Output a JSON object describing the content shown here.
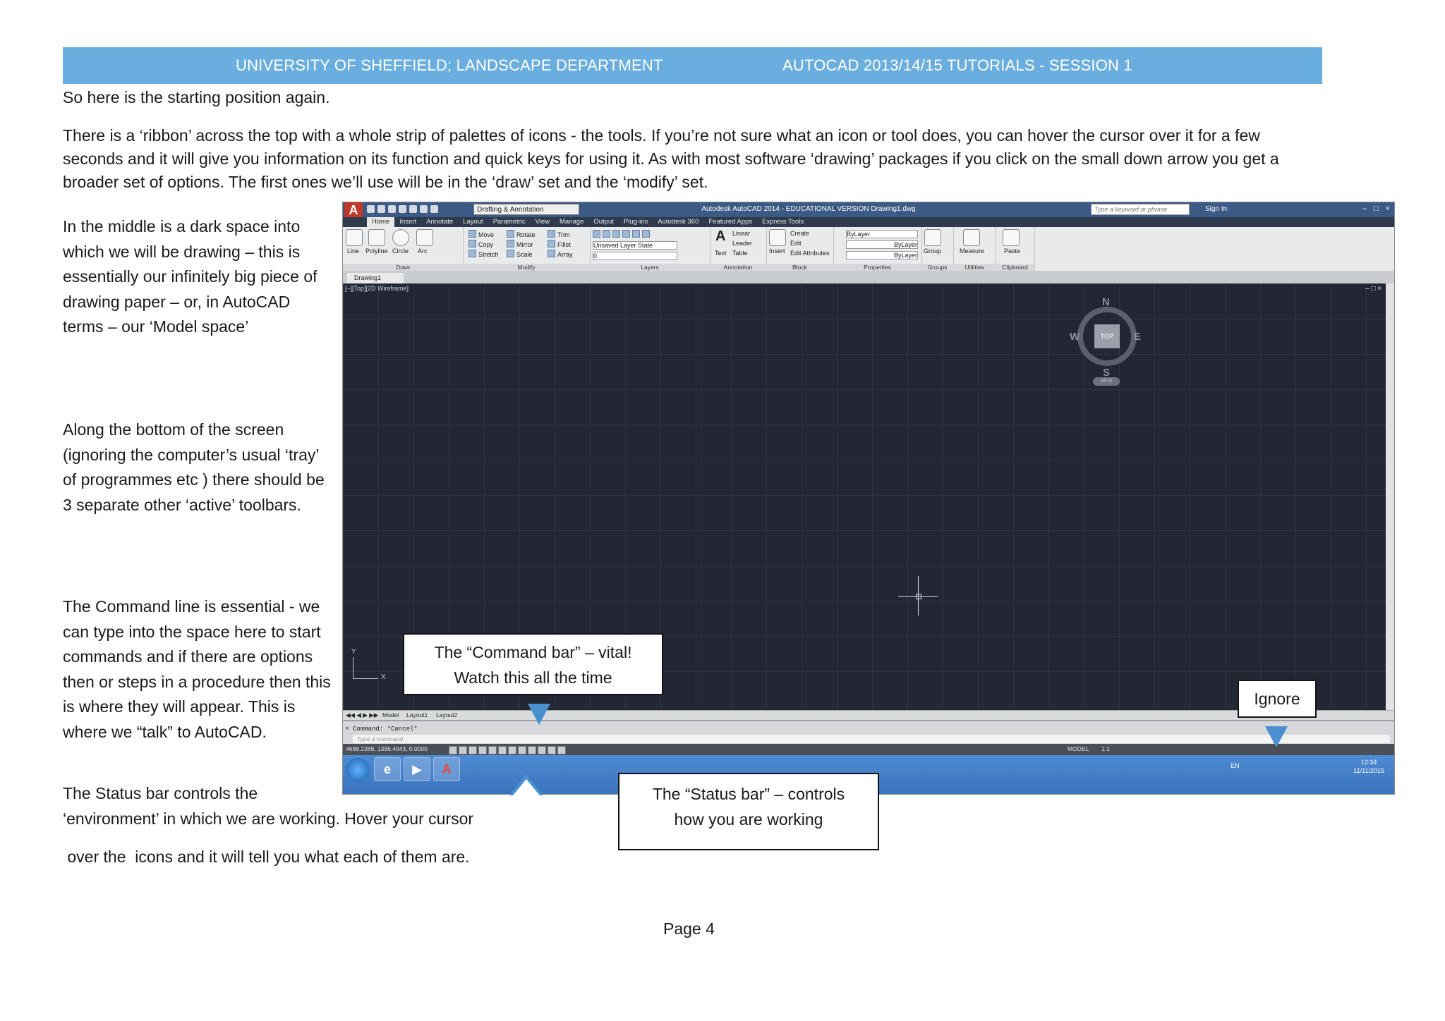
{
  "header": {
    "left": "UNIVERSITY OF SHEFFIELD; LANDSCAPE DEPARTMENT",
    "right": "AUTOCAD 2013/14/15 TUTORIALS -  SESSION 1"
  },
  "intro": "So here is the starting position again.",
  "ribbon_para": "There is a ‘ribbon’ across the top  with  a whole strip of palettes of icons - the tools.  If you’re not sure what an icon or tool does, you can hover the cursor over it for a few seconds and it will give you information on its function and quick keys for using it. As with most software ‘drawing’  packages if you click on the small down arrow you get a broader set of options.  The first ones we’ll use will be in the ‘draw’ set and the ‘modify’ set.",
  "side": {
    "middle": "In the middle is  a dark space into which we will be drawing – this is essentially our infinitely big piece of drawing paper – or, in AutoCAD terms – our ‘Model space’",
    "bottom": "Along the bottom  of the screen (ignoring the  computer’s usual ‘tray’ of  programmes etc )  there should be 3 separate  other ‘active’ toolbars.",
    "command": "The Command line is essential - we  can type into the space here to start commands and if there are options then or steps in a procedure then  this is where they will appear.  This is where we  “talk” to AutoCAD.",
    "status_a": "The Status bar  controls the",
    "status_b": "‘environment’ in which we are working.    Hover your cursor",
    "status_c": " over the  icons and it will tell you what each of them are."
  },
  "callouts": {
    "command_1": "The “Command bar” – vital!",
    "command_2": "Watch this all the time",
    "ignore": "Ignore",
    "status_1": "The “Status bar” – controls",
    "status_2": "how you are working"
  },
  "page_number": "Page 4",
  "autocad": {
    "logo": "A",
    "workspace": "Drafting & Annotation",
    "title": "Autodesk AutoCAD 2014 - EDUCATIONAL VERSION   Drawing1.dwg",
    "search_placeholder": "Type a keyword or phrase",
    "sign_in": "Sign In",
    "tabs": [
      "Home",
      "Insert",
      "Annotate",
      "Layout",
      "Parametric",
      "View",
      "Manage",
      "Output",
      "Plug-ins",
      "Autodesk 360",
      "Featured Apps",
      "Express Tools"
    ],
    "panels": {
      "draw": "Draw",
      "modify": "Modify",
      "layers": "Layers",
      "annotation": "Annotation",
      "block": "Block",
      "properties": "Properties",
      "groups": "Groups",
      "utilities": "Utilities",
      "clipboard": "Clipboard"
    },
    "draw_tools": [
      "Line",
      "Polyline",
      "Circle",
      "Arc"
    ],
    "modify_tools": [
      "Move",
      "Rotate",
      "Trim",
      "Copy",
      "Mirror",
      "Fillet",
      "Stretch",
      "Scale",
      "Array"
    ],
    "layer_state": "Unsaved Layer State",
    "layer_current": "0",
    "annotation_tools": [
      "Text",
      "Linear",
      "Leader",
      "Table"
    ],
    "block_tools": [
      "Insert",
      "Create",
      "Edit",
      "Edit Attributes"
    ],
    "properties_vals": [
      "ByLayer",
      "ByLayer",
      "ByLayer"
    ],
    "groups_tool": "Group",
    "utilities_tool": "Measure",
    "clipboard_tool": "Paste",
    "doc_tab": "Drawing1",
    "viewport_label": "[–][Top][2D Wireframe]",
    "viewport_ctrls": "– □ ×",
    "compass": {
      "n": "N",
      "s": "S",
      "e": "E",
      "w": "W",
      "top": "TOP",
      "wcs": "WCS"
    },
    "ucs": {
      "x": "X",
      "y": "Y"
    },
    "layout_tabs": [
      "Model",
      "Layout1",
      "Layout2"
    ],
    "command_history": "Command: *Cancel*",
    "command_placeholder": "Type a command",
    "coordinates": "4686.2368, 1396.4043, 0.0000",
    "model_label": "MODEL",
    "scale_label": "1:1",
    "lang": "EN",
    "clock_time": "12:34",
    "clock_date": "11/11/2015"
  }
}
